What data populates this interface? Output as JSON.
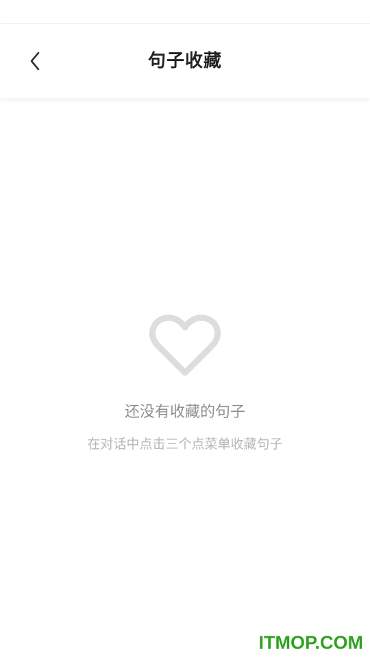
{
  "header": {
    "title": "句子收藏",
    "back_icon": "chevron-left-icon"
  },
  "empty_state": {
    "icon": "heart-outline-icon",
    "icon_color": "#dddddd",
    "title": "还没有收藏的句子",
    "hint": "在对话中点击三个点菜单收藏句子"
  },
  "watermark": {
    "text": "ITMOP.COM",
    "color": "#2fa21f"
  }
}
